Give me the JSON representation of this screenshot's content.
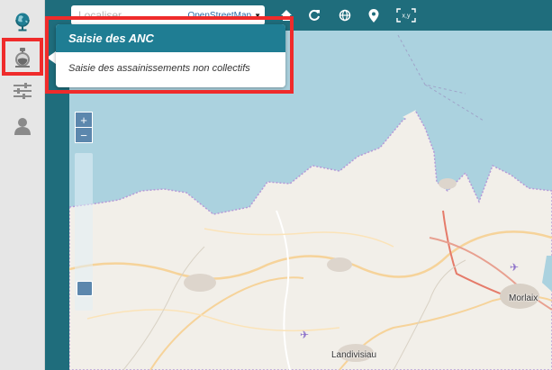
{
  "toolbar": {
    "search_placeholder": "Localiser",
    "basemap_label": "OpenStreetMap",
    "xy_label": "x,y"
  },
  "tooltip": {
    "title": "Saisie des ANC",
    "description": "Saisie des assainissements non collectifs"
  },
  "map": {
    "places": [
      "Morlaix",
      "Landivisiau"
    ],
    "zoom_in_label": "+",
    "zoom_out_label": "−"
  },
  "colors": {
    "accent": "#1f6d7c",
    "tooltip_header": "#1f7d93",
    "highlight": "#ef2b2b",
    "sea": "#abd2df",
    "land": "#f2efe9"
  },
  "icons": [
    "globe-icon",
    "anc-inspection-icon",
    "sliders-icon",
    "user-icon",
    "home-icon",
    "refresh-icon",
    "world-icon",
    "map-pin-icon",
    "xy-coordinates-icon",
    "airport-icon"
  ]
}
